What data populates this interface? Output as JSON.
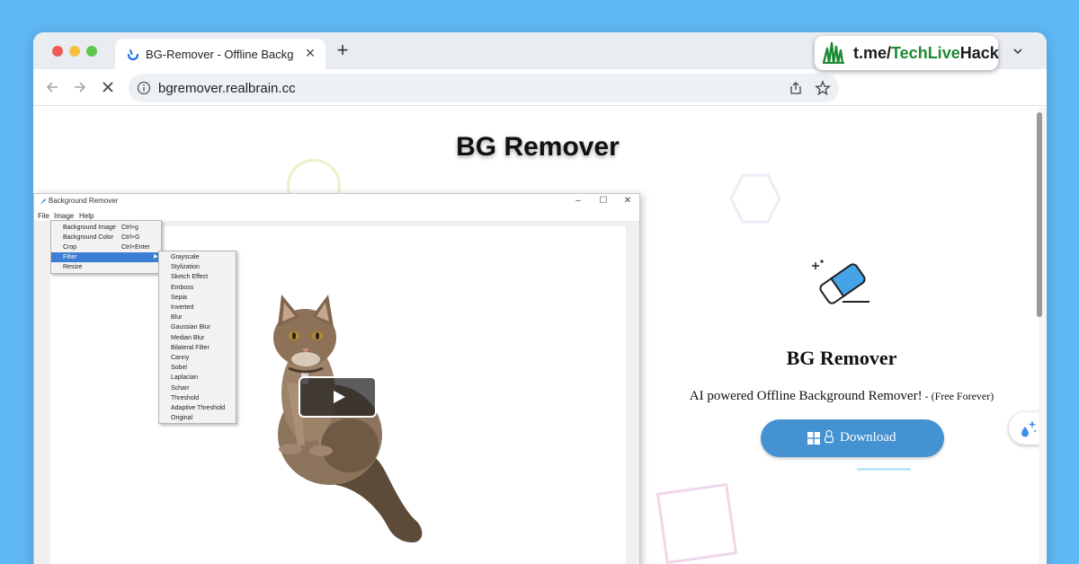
{
  "browser": {
    "tab_title": "BG-Remover - Offline Background Remover",
    "tab_close": "×",
    "new_tab": "+",
    "url": "bgremover.realbrain.cc"
  },
  "badge": {
    "prefix": "t.me/",
    "highlight": "TechLive",
    "suffix": "Hack"
  },
  "page": {
    "heading": "BG Remover",
    "product_title": "BG Remover",
    "description": "AI powered Offline Background Remover!",
    "description_note": " - (Free Forever)",
    "download_label": "Download"
  },
  "app": {
    "title": "Background Remover",
    "controls": {
      "minimize": "–",
      "maximize": "☐",
      "close": "✕"
    },
    "menubar": {
      "file": "File",
      "image": "Image",
      "help": "Help"
    },
    "image_menu": [
      {
        "label": "Background Image",
        "shortcut": "Ctrl+g"
      },
      {
        "label": "Background Color",
        "shortcut": "Ctrl+G"
      },
      {
        "label": "Crop",
        "shortcut": "Ctrl+Enter"
      },
      {
        "label": "Filter",
        "shortcut": ""
      },
      {
        "label": "Resize",
        "shortcut": ""
      }
    ],
    "filter_menu": [
      "Grayscale",
      "Stylization",
      "Sketch Effect",
      "Emboss",
      "Sepia",
      "Inverted",
      "Blur",
      "Gaussian Blur",
      "Median Blur",
      "Bilateral Filter",
      "Canny",
      "Sobel",
      "Laplacian",
      "Scharr",
      "Threshold",
      "Adaptive Threshold",
      "Original"
    ]
  },
  "colors": {
    "accent": "#4592d2",
    "menu_highlight": "#3b7ed3",
    "badge_highlight": "#1d8a34",
    "page_background": "#5fb8f3"
  }
}
